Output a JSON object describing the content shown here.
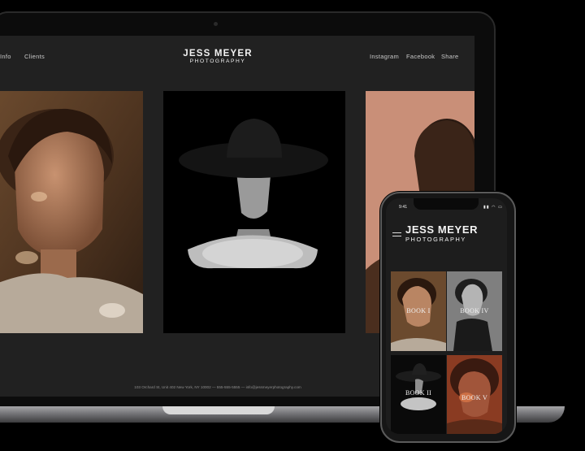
{
  "website": {
    "nav_left": [
      "Info",
      "Clients"
    ],
    "brand": {
      "title": "JESS MEYER",
      "subtitle": "PHOTOGRAPHY"
    },
    "nav_right": [
      "Instagram",
      "Facebook",
      "Share"
    ],
    "footer": "103 Orchard St, Unit 402 New York, NY 10002  —  555-555-5555  —  info@jessmeyerphotography.com"
  },
  "phone": {
    "status_time": "9:41",
    "brand": {
      "title": "JESS MEYER",
      "subtitle": "PHOTOGRAPHY"
    },
    "menu_icon": "hamburger-icon",
    "tiles": [
      "BOOK I",
      "BOOK IV",
      "BOOK II",
      "BOOK V"
    ]
  },
  "colors": {
    "background": "#000000",
    "site_background": "#212121",
    "text": "#f2f2f2"
  }
}
